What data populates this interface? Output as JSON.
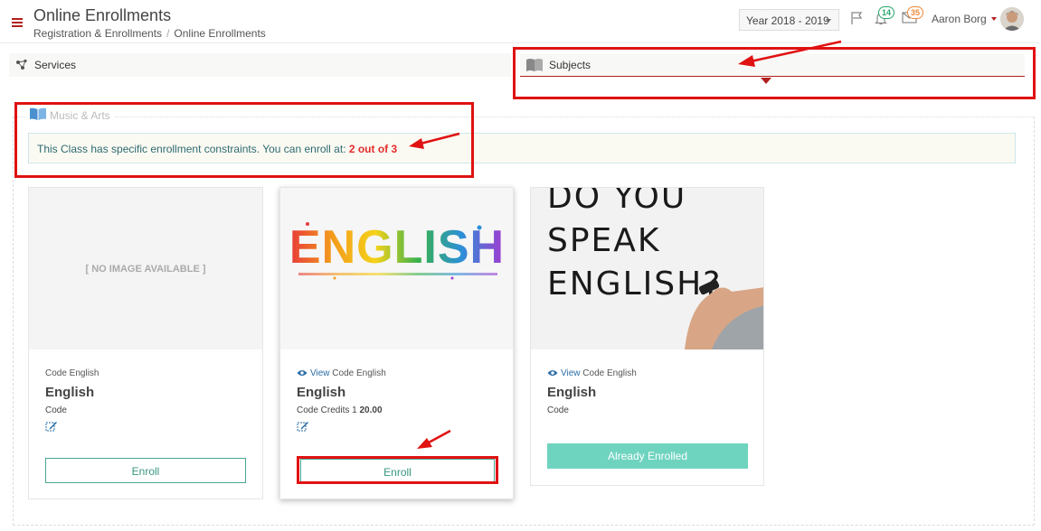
{
  "header": {
    "title": "Online Enrollments",
    "breadcrumb": [
      "Registration & Enrollments",
      "Online Enrollments"
    ],
    "year_select": "Year 2018 - 2019",
    "notifications_count": "14",
    "messages_count": "35",
    "user_name": "Aaron Borg",
    "icons": [
      "menu-icon",
      "flag-icon",
      "bell-icon",
      "envelope-icon"
    ]
  },
  "tabs": [
    {
      "label": "Services",
      "icon": "network-icon"
    },
    {
      "label": "Subjects",
      "icon": "book-icon",
      "active": true
    }
  ],
  "section": {
    "title": "Music & Arts",
    "notice_text": "This Class has specific enrollment constraints. You can enroll at: ",
    "notice_value": "2 out of 3"
  },
  "cards": [
    {
      "image_text": "[ NO IMAGE AVAILABLE ]",
      "code_line": "Code English",
      "name": "English",
      "sub": "Code",
      "button": "Enroll"
    },
    {
      "image_text": "ENGLISH",
      "view_label": "View",
      "code_line": "Code English",
      "name": "English",
      "sub": "Code Credits 1",
      "credits_value": "20.00",
      "button": "Enroll"
    },
    {
      "image_text": [
        "DO YOU",
        "SPEAK",
        "ENGLISH?"
      ],
      "view_label": "View",
      "code_line": "Code English",
      "name": "English",
      "sub": "Code",
      "button": "Already Enrolled"
    }
  ],
  "colors": {
    "accent_red": "#b21f1f",
    "annotation_red": "#e01212",
    "enroll_green": "#37967e",
    "enrolled_bg": "#6fd4bf",
    "link_blue": "#2a6ca6",
    "notif_badge": "#27a86b",
    "msg_badge": "#f0883a"
  }
}
